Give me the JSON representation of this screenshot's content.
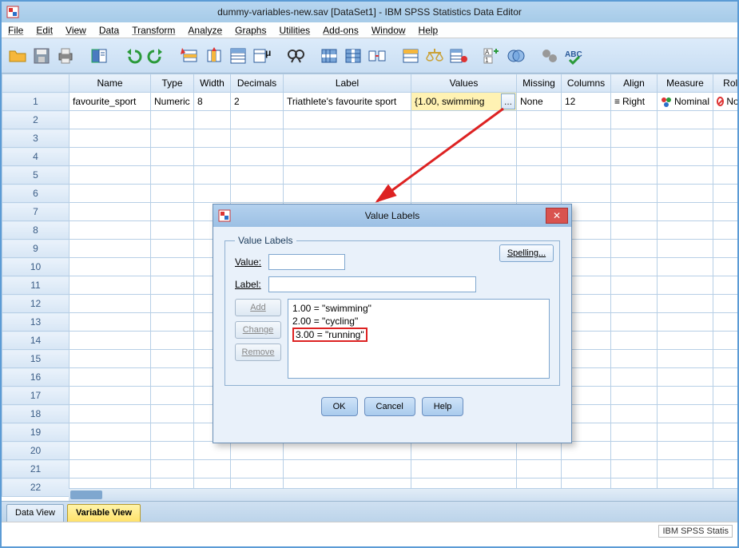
{
  "window": {
    "title": "dummy-variables-new.sav [DataSet1] - IBM SPSS Statistics Data Editor"
  },
  "menu": {
    "file": "File",
    "edit": "Edit",
    "view": "View",
    "data": "Data",
    "transform": "Transform",
    "analyze": "Analyze",
    "graphs": "Graphs",
    "utilities": "Utilities",
    "addons": "Add-ons",
    "window": "Window",
    "help": "Help"
  },
  "columns": {
    "name": "Name",
    "type": "Type",
    "width": "Width",
    "decimals": "Decimals",
    "label": "Label",
    "values": "Values",
    "missing": "Missing",
    "columns_": "Columns",
    "align": "Align",
    "measure": "Measure",
    "role": "Role"
  },
  "row1": {
    "name": "favourite_sport",
    "type": "Numeric",
    "width": "8",
    "decimals": "2",
    "label": "Triathlete's favourite sport",
    "values_text": "{1.00, swimming",
    "values_btn": "...",
    "missing": "None",
    "columns_": "12",
    "align": "Right",
    "measure": "Nominal",
    "role": "None"
  },
  "rownums": [
    "1",
    "2",
    "3",
    "4",
    "5",
    "6",
    "7",
    "8",
    "9",
    "10",
    "11",
    "12",
    "13",
    "14",
    "15",
    "16",
    "17",
    "18",
    "19",
    "20",
    "21",
    "22"
  ],
  "tabs": {
    "data_view": "Data View",
    "variable_view": "Variable View"
  },
  "status": {
    "right": "IBM SPSS Statis"
  },
  "dialog": {
    "title": "Value Labels",
    "groupbox": "Value Labels",
    "value_label": "Value:",
    "label_label": "Label:",
    "value_input": "",
    "label_input": "",
    "spelling": "Spelling...",
    "add": "Add",
    "change": "Change",
    "remove": "Remove",
    "items": [
      "1.00 = \"swimming\"",
      "2.00 = \"cycling\"",
      "3.00 = \"running\""
    ],
    "highlight_index": "2",
    "ok": "OK",
    "cancel": "Cancel",
    "help": "Help"
  }
}
